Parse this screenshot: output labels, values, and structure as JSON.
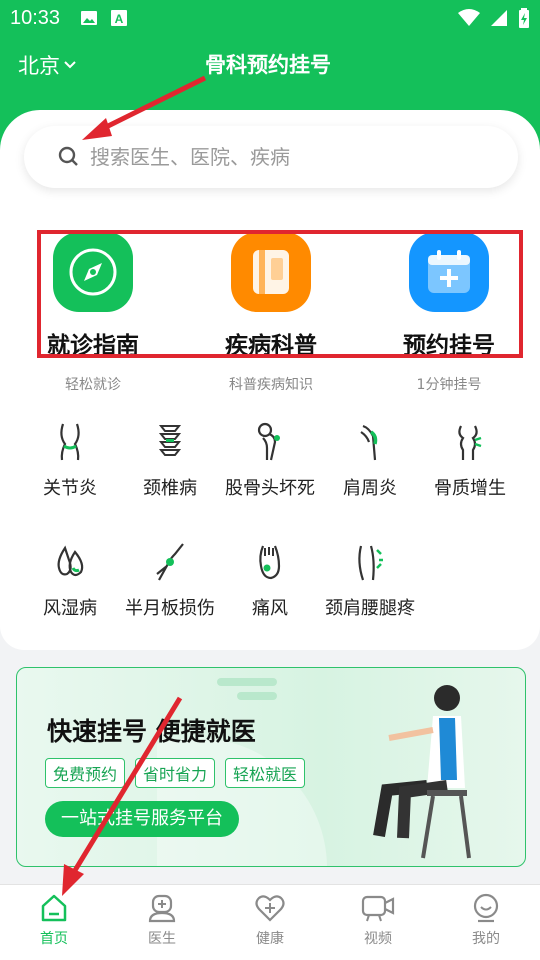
{
  "status_bar": {
    "time": "10:33",
    "left_icons": [
      "image-icon",
      "a-icon"
    ],
    "right_icons": [
      "wifi-icon",
      "signal-icon",
      "battery-icon"
    ]
  },
  "header": {
    "city": "北京",
    "title": "骨科预约挂号",
    "brand_color": "#14c05a"
  },
  "search": {
    "placeholder": "搜索医生、医院、疾病"
  },
  "features": [
    {
      "title": "就诊指南",
      "subtitle": "轻松就诊",
      "icon": "compass-icon",
      "color": "#14c05a"
    },
    {
      "title": "疾病科普",
      "subtitle": "科普疾病知识",
      "icon": "book-icon",
      "color": "#ff8a00"
    },
    {
      "title": "预约挂号",
      "subtitle": "1分钟挂号",
      "icon": "calendar-plus-icon",
      "color": "#1496ff"
    }
  ],
  "diseases": [
    {
      "label": "关节炎",
      "icon": "knee-icon"
    },
    {
      "label": "颈椎病",
      "icon": "spine-icon"
    },
    {
      "label": "股骨头坏死",
      "icon": "femur-icon"
    },
    {
      "label": "肩周炎",
      "icon": "shoulder-icon"
    },
    {
      "label": "骨质增生",
      "icon": "bone-spur-icon"
    },
    {
      "label": "风湿病",
      "icon": "drops-icon"
    },
    {
      "label": "半月板损伤",
      "icon": "meniscus-icon"
    },
    {
      "label": "痛风",
      "icon": "foot-icon"
    },
    {
      "label": "颈肩腰腿疼",
      "icon": "back-pain-icon"
    }
  ],
  "banner": {
    "title": "快速挂号 便捷就医",
    "tags": [
      "免费预约",
      "省时省力",
      "轻松就医"
    ],
    "button": "一站式挂号服务平台"
  },
  "tabbar": [
    {
      "label": "首页",
      "icon": "home-icon",
      "active": true
    },
    {
      "label": "医生",
      "icon": "doctor-icon",
      "active": false
    },
    {
      "label": "健康",
      "icon": "heart-plus-icon",
      "active": false
    },
    {
      "label": "视频",
      "icon": "video-icon",
      "active": false
    },
    {
      "label": "我的",
      "icon": "smile-icon",
      "active": false
    }
  ],
  "annotation_color": "#e0262f"
}
